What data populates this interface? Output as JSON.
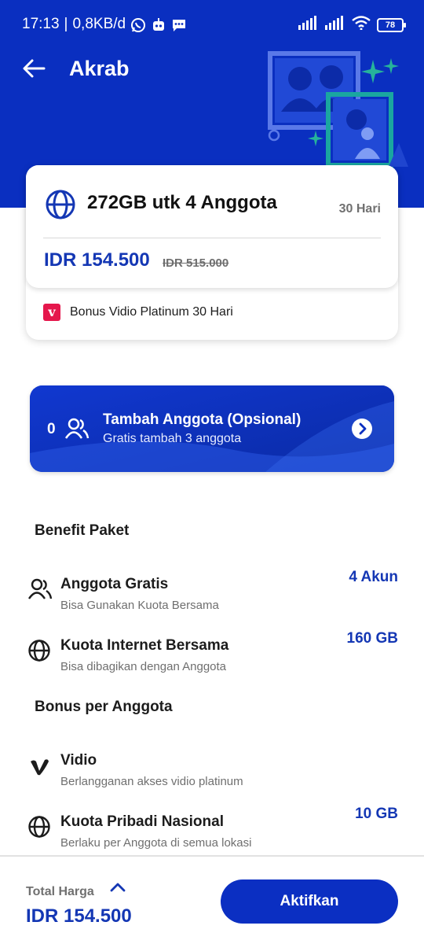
{
  "colors": {
    "brand_blue": "#0a2fc0",
    "price_blue": "#1437b4",
    "vidio_red": "#e5174c"
  },
  "status_bar": {
    "time": "17:13",
    "speed": "0,8KB/d",
    "battery": "78"
  },
  "header": {
    "title": "Akrab"
  },
  "package": {
    "name": "272GB utk 4 Anggota",
    "duration": "30 Hari",
    "price": "IDR 154.500",
    "old_price": "IDR 515.000",
    "bonus": "Bonus Vidio Platinum 30 Hari",
    "bonus_logo": "v"
  },
  "member_banner": {
    "count": "0",
    "title": "Tambah Anggota (Opsional)",
    "subtitle": "Gratis tambah 3 anggota"
  },
  "benefits": {
    "title": "Benefit Paket",
    "items": [
      {
        "icon": "people-icon",
        "title": "Anggota Gratis",
        "desc": "Bisa Gunakan Kuota Bersama",
        "value": "4 Akun"
      },
      {
        "icon": "globe-icon",
        "title": "Kuota Internet Bersama",
        "desc": "Bisa dibagikan dengan Anggota",
        "value": "160 GB"
      }
    ]
  },
  "member_bonus": {
    "title": "Bonus per Anggota",
    "items": [
      {
        "icon": "vidio-icon",
        "title": "Vidio",
        "desc": "Berlangganan akses vidio platinum",
        "value": ""
      },
      {
        "icon": "globe-icon",
        "title": "Kuota Pribadi Nasional",
        "desc": "Berlaku per Anggota di semua lokasi",
        "value": "10 GB"
      }
    ]
  },
  "footer": {
    "total_label": "Total Harga",
    "total_price": "IDR 154.500",
    "activate_label": "Aktifkan"
  }
}
